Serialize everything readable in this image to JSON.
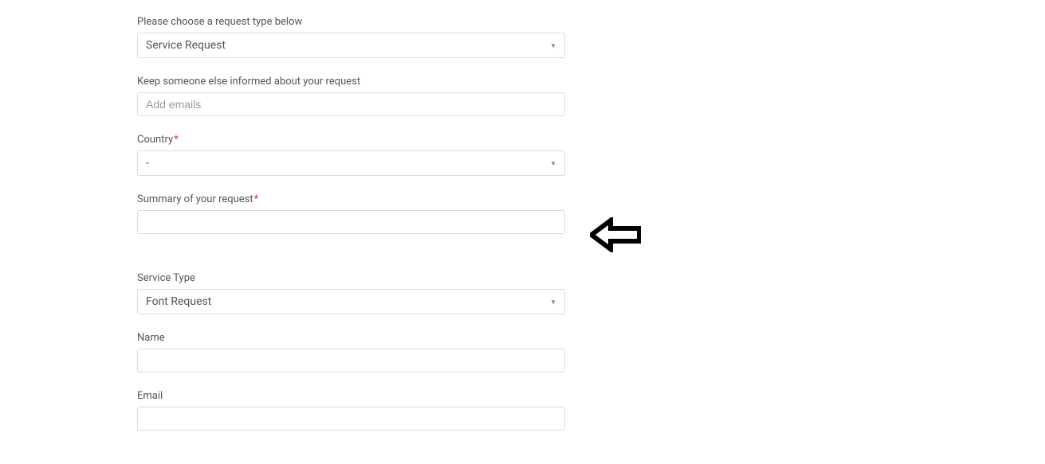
{
  "form": {
    "requestType": {
      "label": "Please choose a request type below",
      "value": "Service Request"
    },
    "keepInformed": {
      "label": "Keep someone else informed about your request",
      "placeholder": "Add emails",
      "value": ""
    },
    "country": {
      "label": "Country",
      "value": "-"
    },
    "summary": {
      "label": "Summary of your request",
      "value": ""
    },
    "serviceType": {
      "label": "Service Type",
      "value": "Font Request"
    },
    "name": {
      "label": "Name",
      "value": ""
    },
    "email": {
      "label": "Email",
      "value": ""
    }
  },
  "requiredMark": "*"
}
